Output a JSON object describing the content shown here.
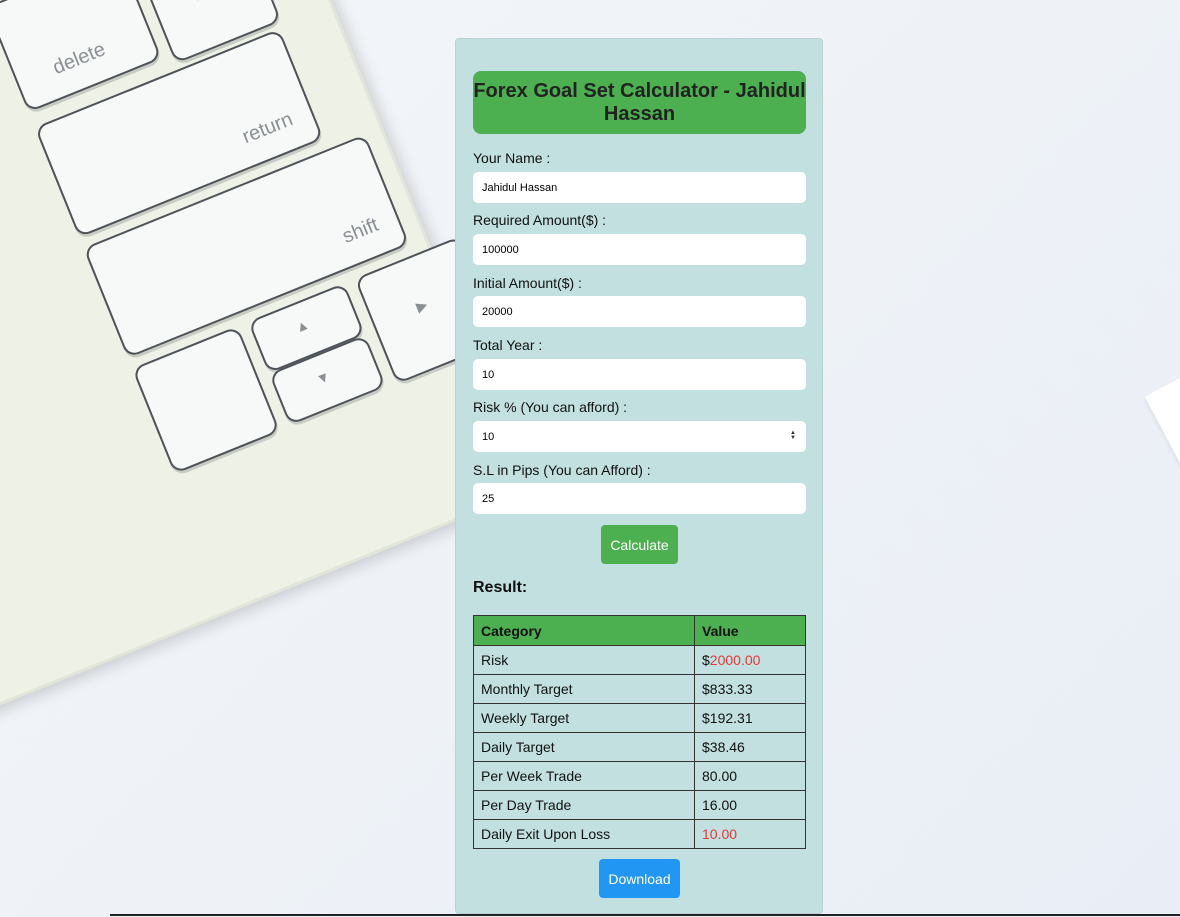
{
  "background": {
    "keyboard_keys": {
      "delete": "delete",
      "backslash": "| \\",
      "return": "return",
      "shift": "shift",
      "up": "▲",
      "down": "▼",
      "right": "▶"
    }
  },
  "app": {
    "title": "Forex Goal Set Calculator - Jahidul Hassan",
    "accent_color": "#4caf50",
    "download_color": "#2196f3"
  },
  "form": {
    "fields": [
      {
        "label": "Your Name :",
        "value": "Jahidul Hassan"
      },
      {
        "label": "Required Amount($) :",
        "value": "100000"
      },
      {
        "label": "Initial Amount($) :",
        "value": "20000"
      },
      {
        "label": "Total Year :",
        "value": "10"
      },
      {
        "label": "Risk % (You can afford) :",
        "value": "10"
      },
      {
        "label": "S.L in Pips (You can Afford) :",
        "value": "25"
      }
    ],
    "calculate_label": "Calculate"
  },
  "result": {
    "heading": "Result:",
    "columns": [
      "Category",
      "Value"
    ],
    "rows": [
      {
        "category": "Risk",
        "prefix": "$",
        "value": "2000.00"
      },
      {
        "category": "Monthly Target",
        "prefix": "$",
        "value": "833.33"
      },
      {
        "category": "Weekly Target",
        "prefix": "$",
        "value": "192.31"
      },
      {
        "category": "Daily Target",
        "prefix": "$",
        "value": "38.46"
      },
      {
        "category": "Per Week Trade",
        "prefix": "",
        "value": "80.00"
      },
      {
        "category": "Per Day Trade",
        "prefix": "",
        "value": "16.00"
      },
      {
        "category": "Daily Exit Upon Loss",
        "prefix": "",
        "value": "10.00"
      }
    ],
    "download_label": "Download"
  }
}
